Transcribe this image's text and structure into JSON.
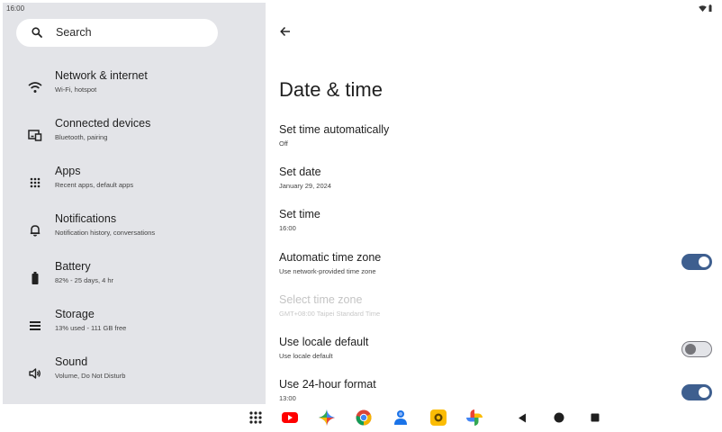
{
  "status_bar": {
    "time": "16:00",
    "icons": [
      "wifi-icon",
      "battery-icon"
    ]
  },
  "search": {
    "label": "Search",
    "icon": "search-icon"
  },
  "sidebar": {
    "items": [
      {
        "title": "Network & internet",
        "subtitle": "Wi-Fi, hotspot",
        "icon": "wifi-icon"
      },
      {
        "title": "Connected devices",
        "subtitle": "Bluetooth, pairing",
        "icon": "devices-icon"
      },
      {
        "title": "Apps",
        "subtitle": "Recent apps, default apps",
        "icon": "apps-grid-icon"
      },
      {
        "title": "Notifications",
        "subtitle": "Notification history, conversations",
        "icon": "bell-icon"
      },
      {
        "title": "Battery",
        "subtitle": "82% - 25 days, 4 hr",
        "icon": "battery-icon"
      },
      {
        "title": "Storage",
        "subtitle": "13% used - 111 GB free",
        "icon": "storage-icon"
      },
      {
        "title": "Sound",
        "subtitle": "Volume, Do Not Disturb",
        "icon": "volume-icon"
      }
    ]
  },
  "page": {
    "title": "Date & time",
    "back_icon": "arrow-back-icon",
    "settings": [
      {
        "title": "Set time automatically",
        "subtitle": "Off"
      },
      {
        "title": "Set date",
        "subtitle": "January 29, 2024"
      },
      {
        "title": "Set time",
        "subtitle": "16:00"
      },
      {
        "title": "Automatic time zone",
        "subtitle": "Use network-provided time zone",
        "toggle": true
      },
      {
        "title": "Select time zone",
        "subtitle": "GMT+08:00 Taipei Standard Time",
        "disabled": true
      },
      {
        "title": "Use locale default",
        "subtitle": "Use locale default",
        "toggle": false
      },
      {
        "title": "Use 24-hour format",
        "subtitle": "13:00",
        "toggle": true
      }
    ]
  },
  "taskbar": {
    "items": [
      "app-drawer-icon",
      "youtube-icon",
      "gemini-icon",
      "chrome-icon",
      "contacts-icon",
      "camera-icon",
      "photos-icon",
      "back-nav-icon",
      "home-nav-icon",
      "recents-nav-icon"
    ]
  },
  "colors": {
    "accent": "#3e5f8f",
    "sidebar_bg": "#e3e4e8",
    "disabled_text": "#c4c4c4"
  }
}
